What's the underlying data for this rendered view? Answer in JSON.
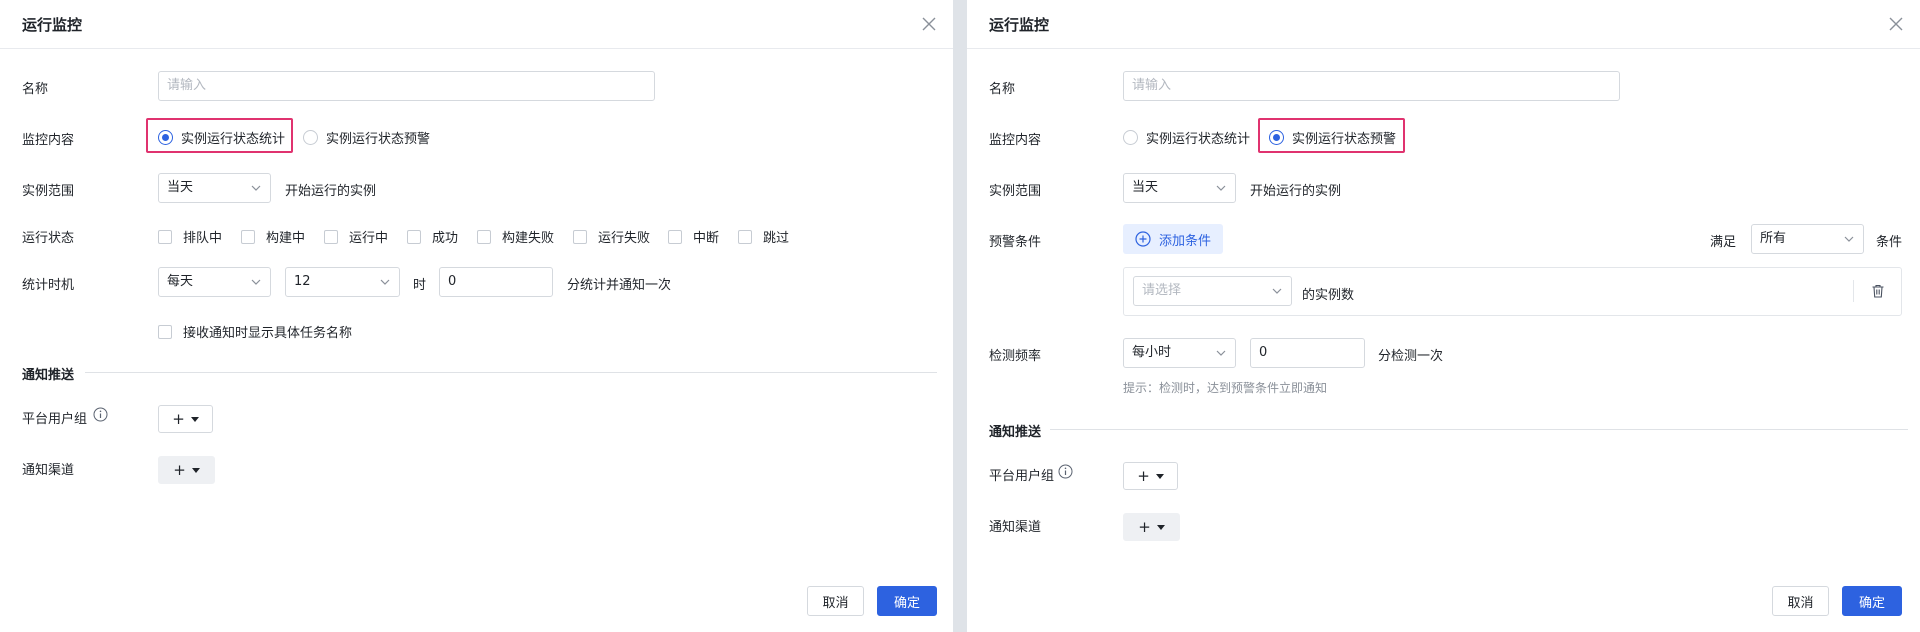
{
  "left": {
    "title": "运行监控",
    "name_label": "名称",
    "name_placeholder": "请输入",
    "content_label": "监控内容",
    "radio_stats": "实例运行状态统计",
    "radio_alert": "实例运行状态预警",
    "selected": "stats",
    "scope_label": "实例范围",
    "scope_value": "当天",
    "scope_suffix": "开始运行的实例",
    "status_label": "运行状态",
    "statuses": [
      "排队中",
      "构建中",
      "运行中",
      "成功",
      "构建失败",
      "运行失败",
      "中断",
      "跳过"
    ],
    "timing_label": "统计时机",
    "timing_freq": "每天",
    "timing_hour": "12",
    "timing_hour_unit": "时",
    "timing_minute": "0",
    "timing_suffix": "分统计并通知一次",
    "show_task_name": "接收通知时显示具体任务名称",
    "notify_section": "通知推送",
    "user_group_label": "平台用户组",
    "channel_label": "通知渠道",
    "plus": "+",
    "cancel": "取消",
    "ok": "确定"
  },
  "right": {
    "title": "运行监控",
    "name_label": "名称",
    "name_placeholder": "请输入",
    "content_label": "监控内容",
    "radio_stats": "实例运行状态统计",
    "radio_alert": "实例运行状态预警",
    "selected": "alert",
    "scope_label": "实例范围",
    "scope_value": "当天",
    "scope_suffix": "开始运行的实例",
    "condition_label": "预警条件",
    "add_condition": "添加条件",
    "satisfy_label": "满足",
    "satisfy_value": "所有",
    "condition_suffix": "条件",
    "cond_select_placeholder": "请选择",
    "cond_text": "的实例数",
    "freq_label": "检测频率",
    "freq_value": "每小时",
    "freq_minute": "0",
    "freq_suffix": "分检测一次",
    "freq_hint": "提示：检测时，达到预警条件立即通知",
    "notify_section": "通知推送",
    "user_group_label": "平台用户组",
    "channel_label": "通知渠道",
    "plus": "+",
    "cancel": "取消",
    "ok": "确定"
  },
  "colors": {
    "primary": "#2d62e0",
    "highlight": "#e0336f"
  }
}
